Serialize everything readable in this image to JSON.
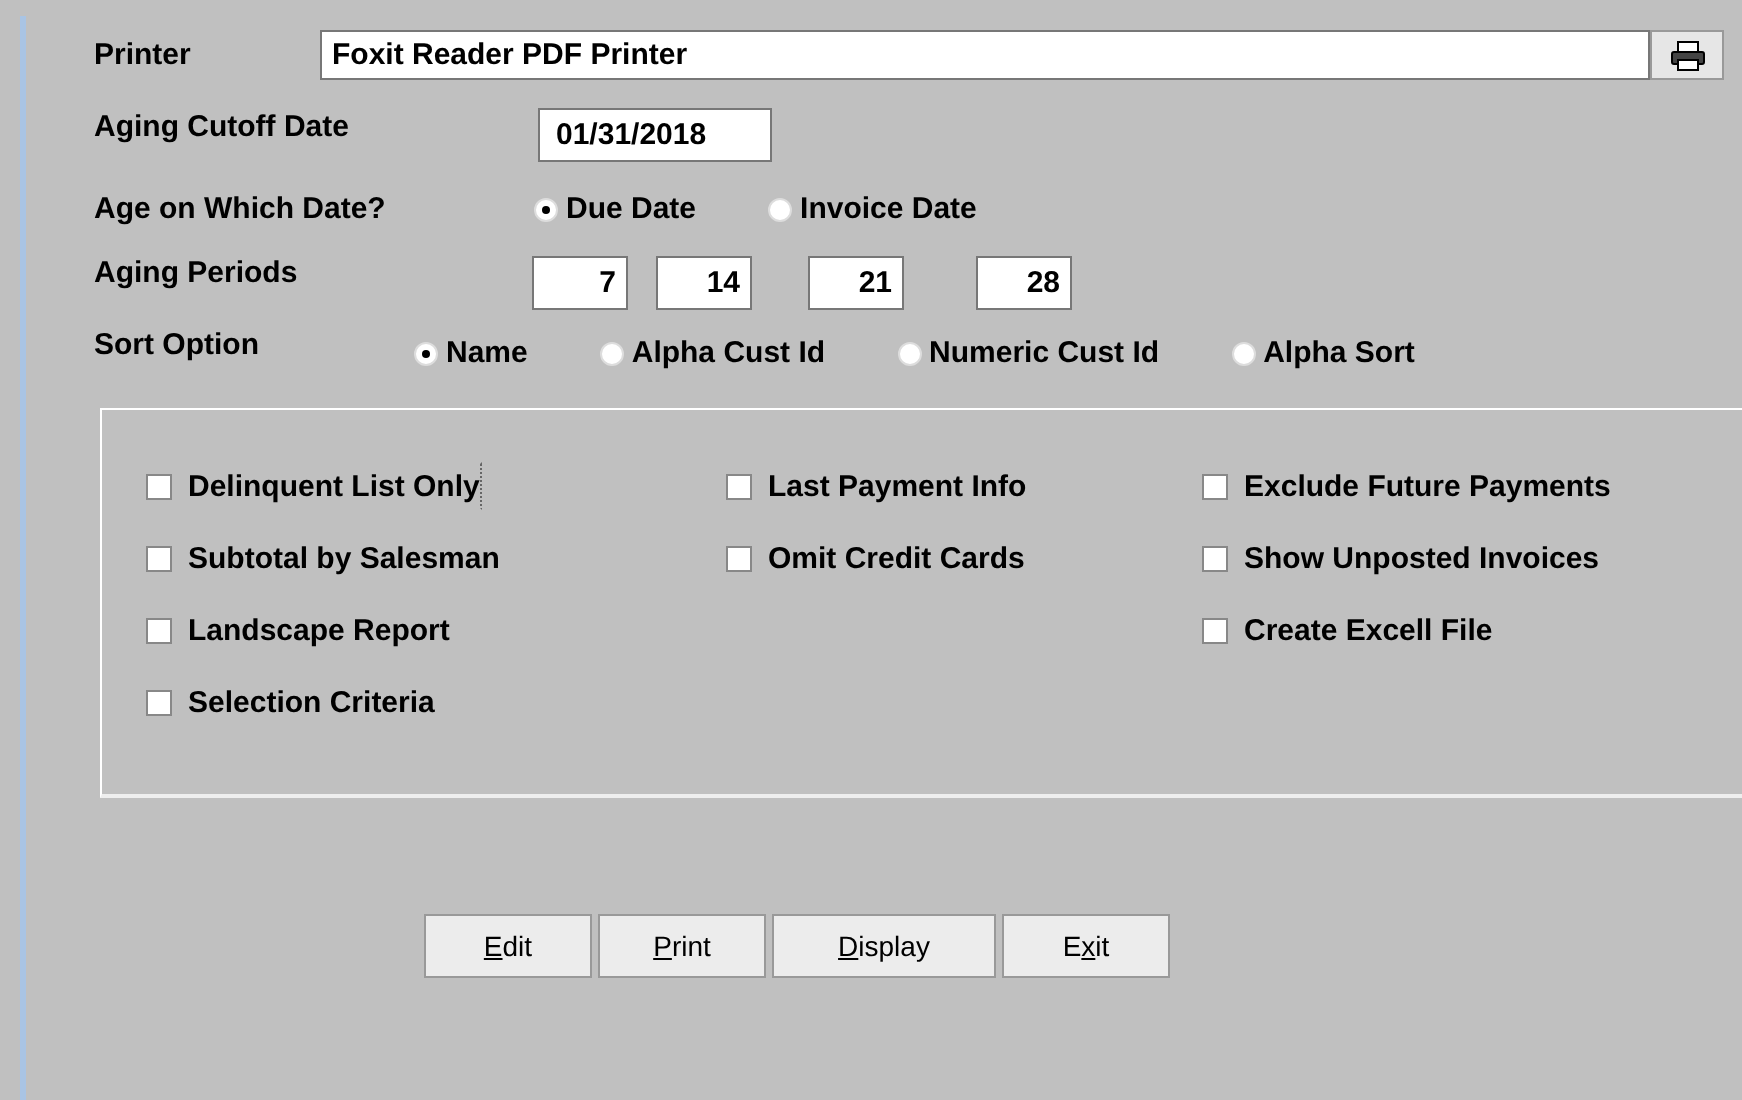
{
  "printer": {
    "label": "Printer",
    "value": "Foxit Reader PDF Printer"
  },
  "cutoff": {
    "label": "Aging Cutoff Date",
    "value": "01/31/2018"
  },
  "age_on": {
    "label": "Age on Which Date?",
    "options": [
      {
        "label": "Due Date",
        "selected": true
      },
      {
        "label": "Invoice Date",
        "selected": false
      }
    ]
  },
  "periods": {
    "label": "Aging Periods",
    "values": [
      "7",
      "14",
      "21",
      "28"
    ]
  },
  "sort": {
    "label": "Sort Option",
    "options": [
      {
        "label": "Name",
        "selected": true
      },
      {
        "label": "Alpha Cust Id",
        "selected": false
      },
      {
        "label": "Numeric Cust Id",
        "selected": false
      },
      {
        "label": "Alpha Sort",
        "selected": false
      }
    ]
  },
  "options": [
    [
      {
        "label": "Delinquent List Only",
        "checked": false,
        "focused": true
      },
      {
        "label": "Subtotal by Salesman",
        "checked": false,
        "focused": false
      },
      {
        "label": "Landscape Report",
        "checked": false,
        "focused": false
      },
      {
        "label": "Selection Criteria",
        "checked": false,
        "focused": false
      }
    ],
    [
      {
        "label": "Last Payment Info",
        "checked": false,
        "focused": false
      },
      {
        "label": "Omit Credit Cards",
        "checked": false,
        "focused": false
      }
    ],
    [
      {
        "label": "Exclude Future Payments",
        "checked": false,
        "focused": false
      },
      {
        "label": "Show Unposted Invoices",
        "checked": false,
        "focused": false
      },
      {
        "label": "Create Excell File",
        "checked": false,
        "focused": false
      }
    ]
  ],
  "buttons": [
    {
      "key": "E",
      "after": "dit"
    },
    {
      "key": "P",
      "after": "rint"
    },
    {
      "key": "D",
      "after": "isplay"
    },
    {
      "before": "E",
      "key": "x",
      "after": "it"
    }
  ]
}
